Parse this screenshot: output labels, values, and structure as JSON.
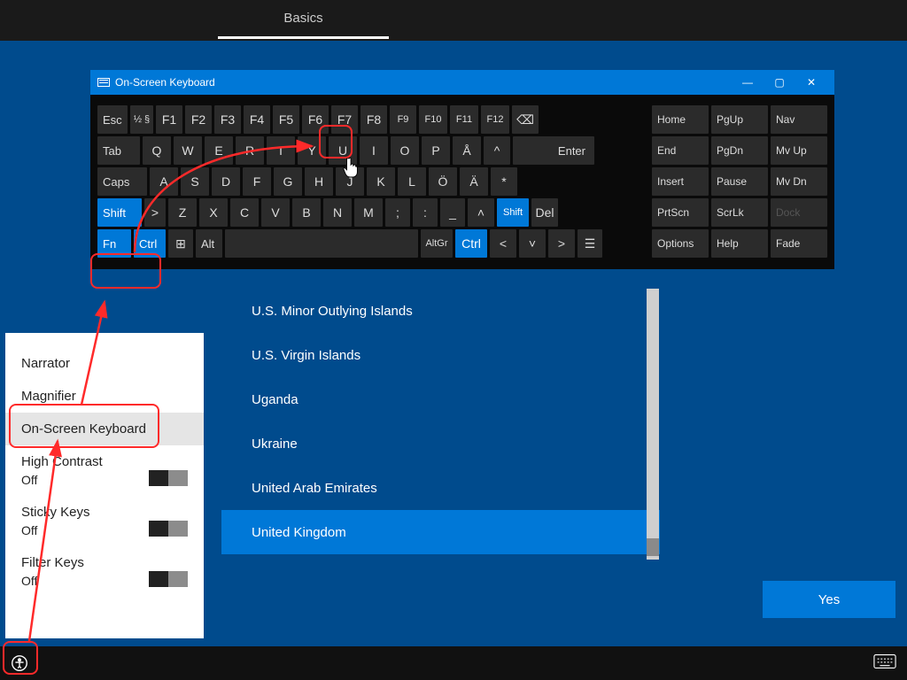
{
  "topbar": {
    "tab_label": "Basics"
  },
  "osk": {
    "title": "On-Screen Keyboard",
    "controls": {
      "min": "—",
      "max": "▢",
      "close": "✕"
    },
    "row0": [
      "Esc",
      "½ §",
      "F1",
      "F2",
      "F3",
      "F4",
      "F5",
      "F6",
      "F7",
      "F8",
      "F9",
      "F10",
      "F11",
      "F12",
      "⌫"
    ],
    "row1": [
      "Tab",
      "Q",
      "W",
      "E",
      "R",
      "T",
      "Y",
      "U",
      "I",
      "O",
      "P",
      "Å",
      "^",
      "Enter"
    ],
    "row2": [
      "Caps",
      "A",
      "S",
      "D",
      "F",
      "G",
      "H",
      "J",
      "K",
      "L",
      "Ö",
      "Ä",
      "*"
    ],
    "row3": [
      "Shift",
      ">",
      "Z",
      "X",
      "C",
      "V",
      "B",
      "N",
      "M",
      ";",
      ":",
      "_",
      "˄",
      "Shift",
      "Del"
    ],
    "row4": [
      "Fn",
      "Ctrl",
      "⊞",
      "Alt",
      "",
      "AltGr",
      "Ctrl",
      "<",
      "˅",
      ">",
      "☰"
    ],
    "right": [
      [
        "Home",
        "PgUp",
        "Nav"
      ],
      [
        "End",
        "PgDn",
        "Mv Up"
      ],
      [
        "Insert",
        "Pause",
        "Mv Dn"
      ],
      [
        "PrtScn",
        "ScrLk",
        "Dock"
      ],
      [
        "Options",
        "Help",
        "Fade"
      ]
    ]
  },
  "countries": [
    "U.S. Minor Outlying Islands",
    "U.S. Virgin Islands",
    "Uganda",
    "Ukraine",
    "United Arab Emirates",
    "United Kingdom"
  ],
  "countries_selected_index": 5,
  "ease": {
    "items": [
      {
        "label": "Narrator"
      },
      {
        "label": "Magnifier"
      },
      {
        "label": "On-Screen Keyboard"
      },
      {
        "label": "High Contrast",
        "state": "Off"
      },
      {
        "label": "Sticky Keys",
        "state": "Off"
      },
      {
        "label": "Filter Keys",
        "state": "Off"
      }
    ]
  },
  "yes_button": "Yes",
  "annotations": {
    "f3_box": true,
    "fn_ctrl_box": true,
    "osk_box": true,
    "ease_btn_box": true
  }
}
